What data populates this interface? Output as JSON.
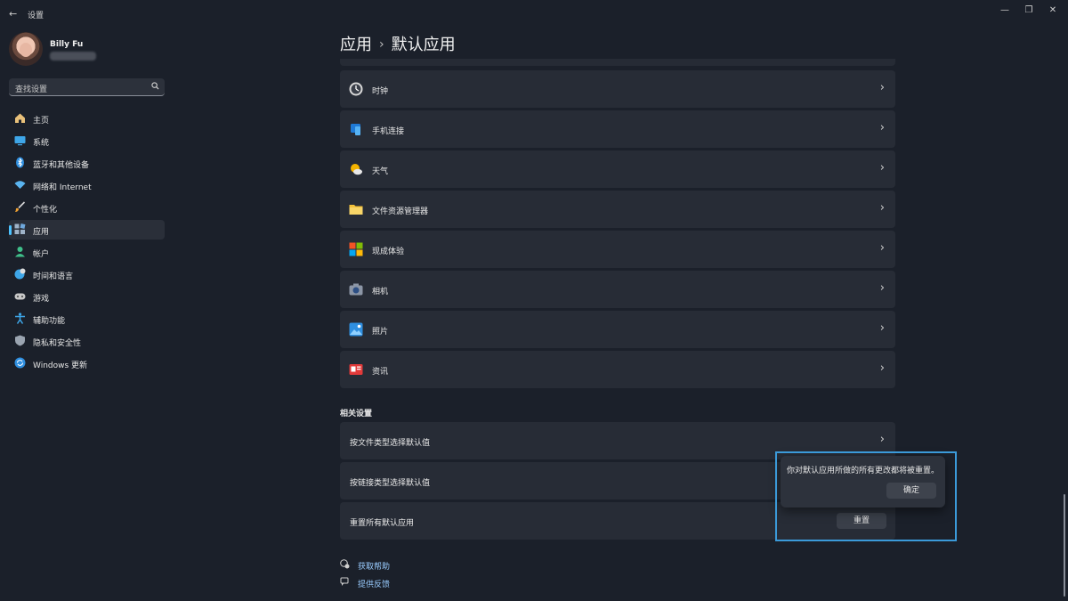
{
  "window": {
    "title": "设置",
    "back_glyph": "←",
    "minimize_glyph": "—",
    "restore_glyph": "❐",
    "close_glyph": "✕"
  },
  "user": {
    "name": "Billy Fu"
  },
  "search": {
    "placeholder": "查找设置",
    "icon": "search-icon"
  },
  "nav": {
    "items": [
      {
        "label": "主页",
        "icon": "home-icon",
        "active": false
      },
      {
        "label": "系统",
        "icon": "system-icon",
        "active": false
      },
      {
        "label": "蓝牙和其他设备",
        "icon": "bluetooth-icon",
        "active": false
      },
      {
        "label": "网络和 Internet",
        "icon": "wifi-icon",
        "active": false
      },
      {
        "label": "个性化",
        "icon": "brush-icon",
        "active": false
      },
      {
        "label": "应用",
        "icon": "apps-icon",
        "active": true
      },
      {
        "label": "帐户",
        "icon": "account-icon",
        "active": false
      },
      {
        "label": "时间和语言",
        "icon": "time-language-icon",
        "active": false
      },
      {
        "label": "游戏",
        "icon": "gamepad-icon",
        "active": false
      },
      {
        "label": "辅助功能",
        "icon": "accessibility-icon",
        "active": false
      },
      {
        "label": "隐私和安全性",
        "icon": "shield-icon",
        "active": false
      },
      {
        "label": "Windows 更新",
        "icon": "update-icon",
        "active": false
      }
    ]
  },
  "breadcrumb": {
    "parent": "应用",
    "separator": "›",
    "current": "默认应用"
  },
  "apps": [
    {
      "label": "时钟",
      "icon": "clock-icon"
    },
    {
      "label": "手机连接",
      "icon": "phone-link-icon"
    },
    {
      "label": "天气",
      "icon": "weather-icon"
    },
    {
      "label": "文件资源管理器",
      "icon": "folder-icon"
    },
    {
      "label": "现成体验",
      "icon": "tiles-icon"
    },
    {
      "label": "相机",
      "icon": "camera-icon"
    },
    {
      "label": "照片",
      "icon": "photos-icon"
    },
    {
      "label": "资讯",
      "icon": "news-icon"
    }
  ],
  "chevron": "›",
  "related": {
    "title": "相关设置",
    "by_file_type": "按文件类型选择默认值",
    "by_link_type": "按链接类型选择默认值",
    "reset_all": "重置所有默认应用",
    "reset_button": "重置"
  },
  "popup": {
    "message": "你对默认应用所做的所有更改都将被重置。",
    "ok_button": "确定"
  },
  "links": {
    "help": "获取帮助",
    "feedback": "提供反馈"
  },
  "colors": {
    "accent": "#4cc2ff",
    "link": "#99ccff",
    "highlight": "#3b9ad9"
  }
}
